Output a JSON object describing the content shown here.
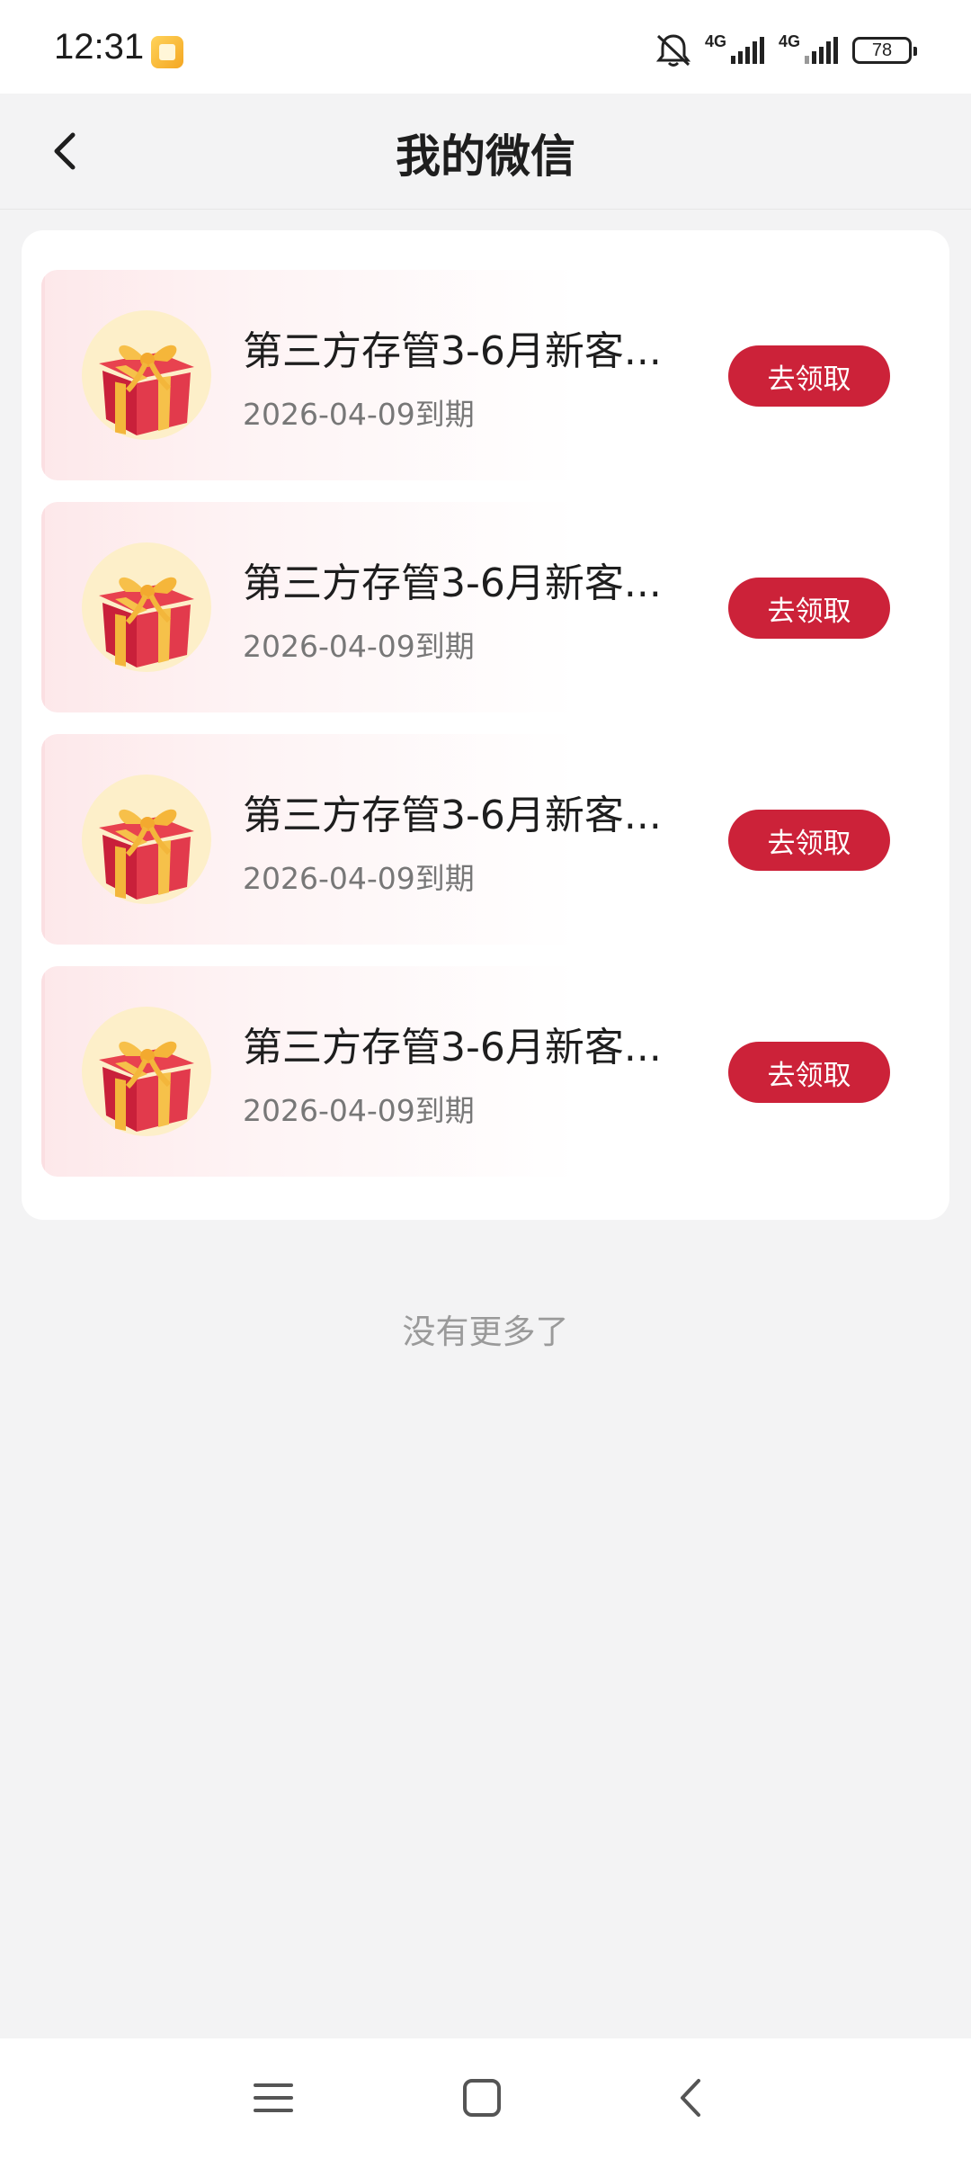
{
  "status_bar": {
    "time": "12:31",
    "network_1": "4G",
    "network_2": "4G",
    "battery": "78"
  },
  "header": {
    "title": "我的微信"
  },
  "coupons": [
    {
      "title": "第三方存管3-6月新客...",
      "expiry": "2026-04-09到期",
      "button": "去领取"
    },
    {
      "title": "第三方存管3-6月新客...",
      "expiry": "2026-04-09到期",
      "button": "去领取"
    },
    {
      "title": "第三方存管3-6月新客...",
      "expiry": "2026-04-09到期",
      "button": "去领取"
    },
    {
      "title": "第三方存管3-6月新客...",
      "expiry": "2026-04-09到期",
      "button": "去领取"
    }
  ],
  "footer_text": "没有更多了",
  "colors": {
    "accent": "#cc2239",
    "background": "#f3f3f4",
    "card": "#ffffff"
  }
}
